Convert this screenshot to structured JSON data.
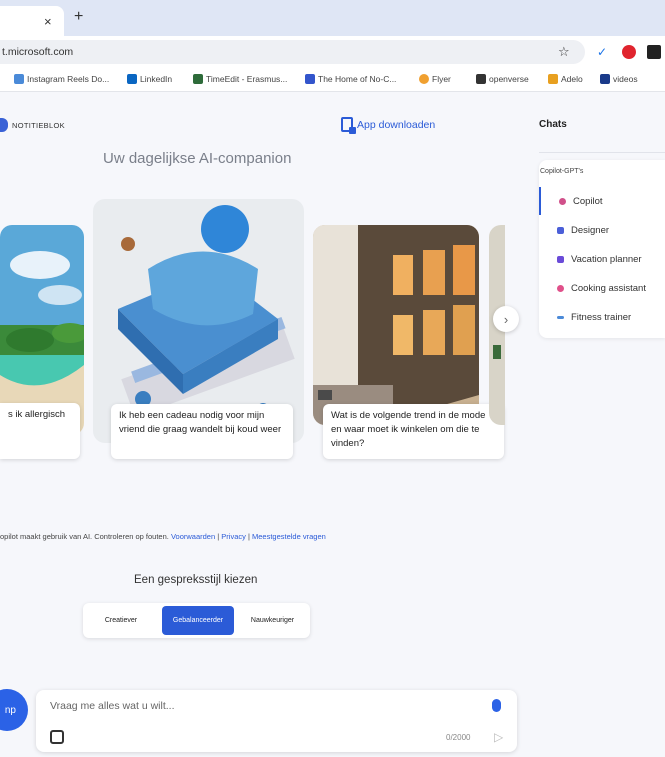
{
  "browser": {
    "tab_close": "×",
    "new_tab": "+",
    "url": "t.microsoft.com",
    "star": "☆",
    "bookmarks": [
      {
        "label": "Instagram Reels Do...",
        "color": "#4a8ad8"
      },
      {
        "label": "LinkedIn",
        "color": "#0a66c2"
      },
      {
        "label": "TimeEdit - Erasmus...",
        "color": "#2e6b3a"
      },
      {
        "label": "The Home of No-C...",
        "color": "#3355cc"
      },
      {
        "label": "Flyer",
        "color": "#f0a030"
      },
      {
        "label": "openverse",
        "color": "#333333"
      },
      {
        "label": "Adelo",
        "color": "#e8a020"
      },
      {
        "label": "videos",
        "color": "#1a3a8a"
      }
    ]
  },
  "header": {
    "logo_text": "NOTITIEBLOK",
    "app_download": "App downloaden",
    "subtitle": "Uw dagelijkse AI-companion"
  },
  "cards": [
    {
      "caption": "s ik allergisch"
    },
    {
      "caption": "Ik heb een cadeau nodig voor mijn vriend die graag wandelt bij koud weer"
    },
    {
      "caption": "Wat is de volgende trend in de mode en waar moet ik winkelen om die te vinden?"
    }
  ],
  "carousel": {
    "next_label": "›"
  },
  "disclaimer": {
    "text": "opilot maakt gebruik van AI. Controleren op fouten.",
    "terms": "Voorwaarden",
    "privacy": "Privacy",
    "faq": "Meestgestelde vragen"
  },
  "conversation_style": {
    "title": "Een gespreksstijl kiezen",
    "options": [
      "Creatiever",
      "Gebalanceerder",
      "Nauwkeuriger"
    ],
    "selected_index": 1
  },
  "chat": {
    "avatar_label": "np",
    "placeholder": "Vraag me alles wat u wilt...",
    "counter": "0/2000",
    "send_label": "▷"
  },
  "sidebar": {
    "title": "Chats",
    "gpts_title": "Copilot-GPT's",
    "items": [
      {
        "label": "Copilot",
        "color": "#d0508a"
      },
      {
        "label": "Designer",
        "color": "#4b5fd8"
      },
      {
        "label": "Vacation planner",
        "color": "#6a4bd8"
      },
      {
        "label": "Cooking assistant",
        "color": "#e0508a"
      },
      {
        "label": "Fitness trainer",
        "color": "#4b8ad8"
      }
    ]
  }
}
